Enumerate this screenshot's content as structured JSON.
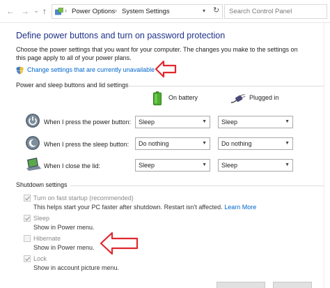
{
  "nav": {
    "back_glyph": "←",
    "forward_glyph": "→",
    "recent_glyph": "⌄",
    "up_glyph": "↑",
    "refresh_glyph": "↻",
    "separator": "›",
    "crumbs": [
      "Power Options",
      "System Settings"
    ],
    "search_placeholder": "Search Control Panel"
  },
  "page": {
    "title": "Define power buttons and turn on password protection",
    "description": "Choose the power settings that you want for your computer. The changes you make to the settings on this page apply to all of your power plans.",
    "change_link": "Change settings that are currently unavailable"
  },
  "power_section": {
    "label": "Power and sleep buttons and lid settings",
    "col_battery": "On battery",
    "col_plugged": "Plugged in",
    "rows": [
      {
        "label": "When I press the power button:",
        "battery": "Sleep",
        "plugged": "Sleep"
      },
      {
        "label": "When I press the sleep button:",
        "battery": "Do nothing",
        "plugged": "Do nothing"
      },
      {
        "label": "When I close the lid:",
        "battery": "Sleep",
        "plugged": "Sleep"
      }
    ]
  },
  "shutdown_section": {
    "label": "Shutdown settings",
    "items": [
      {
        "label": "Turn on fast startup (recommended)",
        "desc": "This helps start your PC faster after shutdown. Restart isn't affected.",
        "link": "Learn More",
        "checked": true
      },
      {
        "label": "Sleep",
        "desc": "Show in Power menu.",
        "checked": true
      },
      {
        "label": "Hibernate",
        "desc": "Show in Power menu.",
        "checked": false
      },
      {
        "label": "Lock",
        "desc": "Show in account picture menu.",
        "checked": true
      }
    ]
  },
  "colors": {
    "title": "#1e3287",
    "link": "#0066cc",
    "annotation_arrow": "#e0282e"
  }
}
